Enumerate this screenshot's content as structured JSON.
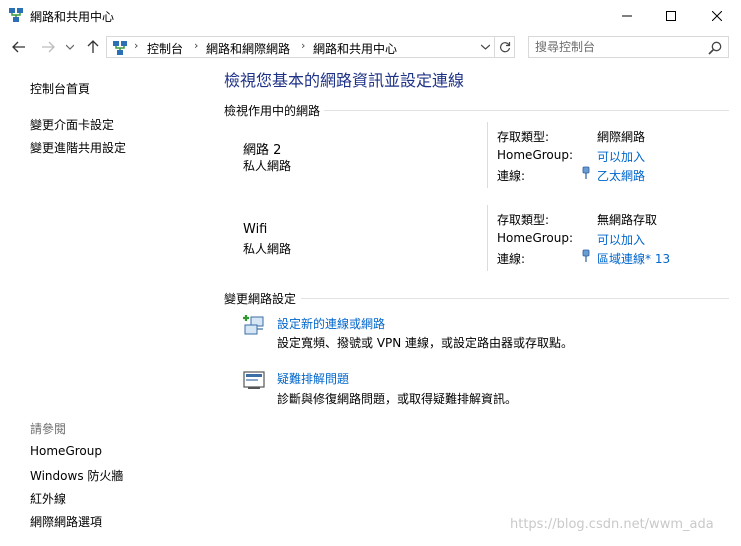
{
  "window": {
    "title": "網路和共用中心",
    "controls": {
      "minimize": "minimize-icon",
      "maximize": "maximize-icon",
      "close": "close-icon"
    }
  },
  "navigation": {
    "breadcrumbs": [
      "控制台",
      "網路和網際網路",
      "網路和共用中心"
    ],
    "search": {
      "placeholder": "搜尋控制台",
      "value": ""
    }
  },
  "sidebar": {
    "links": [
      "控制台首頁",
      "變更介面卡設定",
      "變更進階共用設定"
    ],
    "see_also_heading": "請參閱",
    "see_also": [
      "HomeGroup",
      "Windows 防火牆",
      "紅外線",
      "網際網路選項"
    ]
  },
  "main": {
    "heading": "檢視您基本的網路資訊並設定連線",
    "active_networks_title": "檢視作用中的網路",
    "networks": [
      {
        "name": "網路 2",
        "category": "私人網路",
        "access_type_label": "存取類型:",
        "access_type": "網際網路",
        "homegroup_label": "HomeGroup:",
        "homegroup": "可以加入",
        "connections_label": "連線:",
        "connection": "乙太網路"
      },
      {
        "name": "Wifi",
        "category": "私人網路",
        "access_type_label": "存取類型:",
        "access_type": "無網路存取",
        "homegroup_label": "HomeGroup:",
        "homegroup": "可以加入",
        "connections_label": "連線:",
        "connection": "區域連線* 13"
      }
    ],
    "change_settings_title": "變更網路設定",
    "tasks": [
      {
        "link": "設定新的連線或網路",
        "description": "設定寬頻、撥號或 VPN 連線，或設定路由器或存取點。"
      },
      {
        "link": "疑難排解問題",
        "description": "診斷與修復網路問題，或取得疑難排解資訊。"
      }
    ]
  },
  "watermark": "https://blog.csdn.net/wwm_ada",
  "colors": {
    "heading": "#1e3287",
    "link": "#0066cc",
    "muted": "#6d6d6d"
  }
}
